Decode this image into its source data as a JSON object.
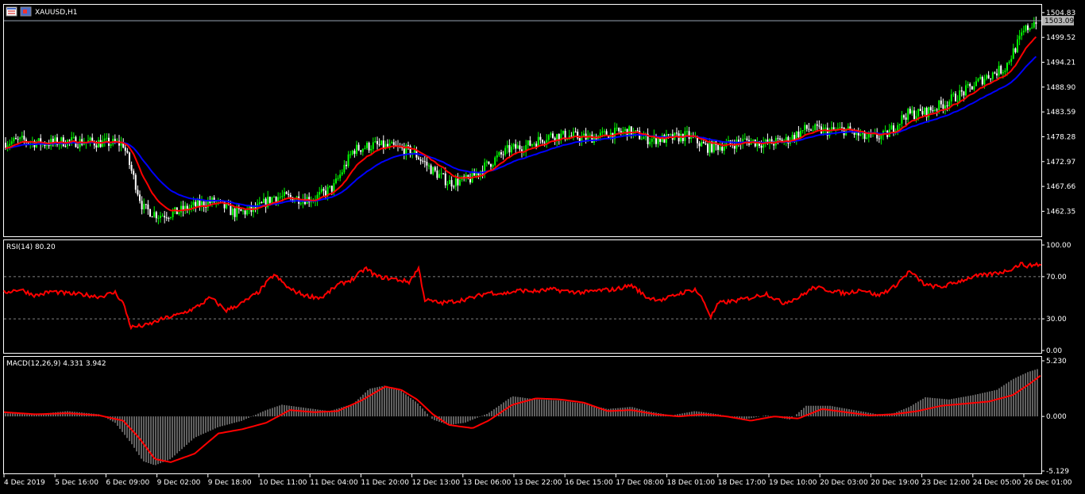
{
  "window": {
    "symbol_label": "XAUUSD,H1",
    "icon": "chart-window-icon"
  },
  "colors": {
    "background": "#000000",
    "frame": "#ffffff",
    "bull_candle": "#00ff00",
    "bear_candle": "#ffffff",
    "ma_fast": "#ff0000",
    "ma_slow": "#0000ff",
    "rsi_line": "#ff0000",
    "macd_hist": "#c0c0c0",
    "macd_signal": "#ff0000",
    "price_label_bg": "#b4b4b4",
    "price_label_text": "#000000",
    "grid_level": "#808080"
  },
  "chart_data": [
    {
      "type": "candlestick",
      "title": "XAUUSD,H1",
      "y_ticks": [
        "1504.83",
        "1499.52",
        "1494.21",
        "1488.90",
        "1483.59",
        "1478.28",
        "1472.97",
        "1467.66",
        "1462.35"
      ],
      "ylim": [
        1457.0,
        1506.5
      ],
      "current_price": "1503.09",
      "indicators": [
        "moving-average-fast",
        "moving-average-slow"
      ],
      "anchors_x": [
        0,
        25,
        50,
        75,
        100,
        125,
        150,
        175,
        195,
        215,
        240,
        265,
        290,
        315,
        340,
        365,
        390,
        415,
        440,
        465,
        490,
        515,
        540,
        560,
        585,
        610,
        635,
        660,
        685,
        710,
        735,
        760,
        785,
        810,
        835,
        860,
        885,
        910,
        935,
        960,
        985,
        1010,
        1035,
        1060,
        1085,
        1110,
        1135,
        1160,
        1185,
        1210,
        1235,
        1260,
        1285,
        1310
      ],
      "close_anchors": [
        1477.0,
        1477.5,
        1476.8,
        1477.3,
        1477.2,
        1477.0,
        1476.8,
        1463.0,
        1461.5,
        1462.0,
        1463.5,
        1464.5,
        1462.0,
        1462.5,
        1465.5,
        1465.2,
        1465.0,
        1467.5,
        1475.5,
        1476.5,
        1476.0,
        1475.0,
        1471.0,
        1468.5,
        1469.0,
        1472.5,
        1475.5,
        1476.5,
        1478.5,
        1478.5,
        1478.0,
        1478.8,
        1479.5,
        1477.8,
        1477.8,
        1478.5,
        1476.0,
        1476.5,
        1477.5,
        1476.8,
        1477.5,
        1480.0,
        1479.5,
        1479.8,
        1478.0,
        1478.5,
        1483.0,
        1483.5,
        1485.5,
        1488.0,
        1491.0,
        1493.0,
        1501.0,
        1504.8
      ]
    },
    {
      "type": "line",
      "title": "RSI(14) 80.20",
      "y_ticks": [
        "100.00",
        "70.00",
        "30.00",
        "0.00"
      ],
      "levels": [
        70,
        30
      ],
      "ylim": [
        0,
        100
      ],
      "anchors_x": [
        0,
        20,
        40,
        60,
        80,
        100,
        120,
        140,
        150,
        160,
        180,
        200,
        220,
        240,
        260,
        280,
        300,
        320,
        340,
        360,
        380,
        400,
        420,
        440,
        455,
        470,
        490,
        510,
        522,
        530,
        550,
        570,
        590,
        610,
        630,
        650,
        670,
        690,
        710,
        730,
        750,
        770,
        790,
        810,
        830,
        850,
        870,
        880,
        890,
        900,
        920,
        940,
        960,
        980,
        1000,
        1020,
        1040,
        1060,
        1080,
        1100,
        1120,
        1140,
        1160,
        1180,
        1200,
        1220,
        1240,
        1260,
        1270,
        1280,
        1290,
        1300,
        1308
      ],
      "values": [
        55,
        58,
        52,
        56,
        54,
        53,
        51,
        55,
        45,
        22,
        24,
        30,
        34,
        40,
        50,
        38,
        45,
        55,
        72,
        58,
        52,
        50,
        62,
        68,
        78,
        70,
        68,
        65,
        78,
        48,
        45,
        47,
        50,
        55,
        54,
        57,
        56,
        58,
        56,
        55,
        57,
        58,
        62,
        50,
        48,
        54,
        58,
        48,
        32,
        45,
        47,
        50,
        54,
        45,
        50,
        60,
        57,
        54,
        58,
        52,
        60,
        75,
        62,
        60,
        65,
        70,
        72,
        75,
        78,
        82,
        80,
        82,
        80
      ]
    },
    {
      "type": "bar",
      "title": "MACD(12,26,9) 4.331 3.942",
      "y_ticks": [
        "5.230",
        "0.000",
        "-5.129"
      ],
      "ylim": [
        -5.129,
        5.23
      ],
      "hist_anchors_x": [
        0,
        40,
        80,
        120,
        140,
        160,
        175,
        190,
        210,
        240,
        270,
        300,
        330,
        350,
        380,
        410,
        440,
        460,
        480,
        500,
        520,
        540,
        560,
        580,
        610,
        640,
        670,
        700,
        730,
        760,
        790,
        810,
        840,
        870,
        900,
        930,
        960,
        990,
        1010,
        1040,
        1070,
        1100,
        1120,
        1140,
        1160,
        1190,
        1220,
        1250,
        1270,
        1290,
        1308
      ],
      "hist_values": [
        0.3,
        0.2,
        0.5,
        0.2,
        -0.6,
        -2.5,
        -4.2,
        -4.6,
        -4.0,
        -2.0,
        -1.0,
        -0.4,
        0.6,
        1.1,
        0.8,
        0.5,
        1.2,
        2.6,
        2.9,
        2.4,
        1.3,
        -0.3,
        -0.8,
        -0.6,
        0.3,
        1.9,
        1.6,
        1.5,
        1.2,
        0.7,
        0.9,
        0.5,
        0.1,
        0.5,
        0.2,
        -0.3,
        0.1,
        -0.3,
        1.0,
        1.0,
        0.6,
        0.2,
        0.3,
        0.9,
        1.8,
        1.6,
        2.0,
        2.5,
        3.5,
        4.2,
        4.6
      ],
      "signal_anchors_x": [
        0,
        40,
        80,
        120,
        150,
        170,
        190,
        210,
        240,
        270,
        300,
        330,
        360,
        390,
        420,
        450,
        480,
        500,
        520,
        540,
        560,
        590,
        610,
        640,
        670,
        700,
        730,
        760,
        790,
        820,
        850,
        880,
        910,
        940,
        970,
        1000,
        1030,
        1060,
        1090,
        1120,
        1150,
        1180,
        1210,
        1240,
        1270,
        1290,
        1308
      ],
      "signal_values": [
        0.4,
        0.2,
        0.3,
        0.1,
        -0.4,
        -2.0,
        -4.0,
        -4.3,
        -3.5,
        -1.6,
        -1.2,
        -0.6,
        0.6,
        0.4,
        0.5,
        1.5,
        2.8,
        2.5,
        1.6,
        0.2,
        -0.8,
        -1.1,
        -0.4,
        1.1,
        1.7,
        1.6,
        1.3,
        0.5,
        0.6,
        0.2,
        0.0,
        0.2,
        0.0,
        -0.4,
        0.0,
        -0.2,
        0.7,
        0.4,
        0.1,
        0.2,
        0.5,
        1.0,
        1.2,
        1.4,
        2.0,
        3.0,
        4.0
      ]
    }
  ],
  "x_axis_labels": [
    "4 Dec 2019",
    "5 Dec 16:00",
    "6 Dec 09:00",
    "9 Dec 02:00",
    "9 Dec 18:00",
    "10 Dec 11:00",
    "11 Dec 04:00",
    "11 Dec 20:00",
    "12 Dec 13:00",
    "13 Dec 06:00",
    "13 Dec 22:00",
    "16 Dec 15:00",
    "17 Dec 08:00",
    "18 Dec 01:00",
    "18 Dec 17:00",
    "19 Dec 10:00",
    "20 Dec 03:00",
    "20 Dec 19:00",
    "23 Dec 12:00",
    "24 Dec 05:00",
    "26 Dec 01:00"
  ]
}
